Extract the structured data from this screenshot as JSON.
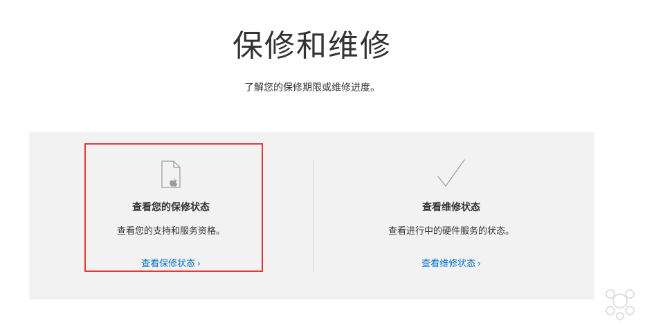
{
  "header": {
    "title": "保修和维修",
    "subtitle": "了解您的保修期限或维修进度。"
  },
  "cards": [
    {
      "icon": "document-apple-icon",
      "title": "查看您的保修状态",
      "description": "查看您的支持和服务资格。",
      "link_label": "查看保修状态",
      "highlighted": true
    },
    {
      "icon": "checkmark-icon",
      "title": "查看维修状态",
      "description": "查看进行中的硬件服务的状态。",
      "link_label": "查看维修状态",
      "highlighted": false
    }
  ],
  "chevron": "›",
  "colors": {
    "link": "#0070c9",
    "panel_bg": "#f2f2f2",
    "highlight_border": "#e03a3a",
    "text": "#333333"
  }
}
